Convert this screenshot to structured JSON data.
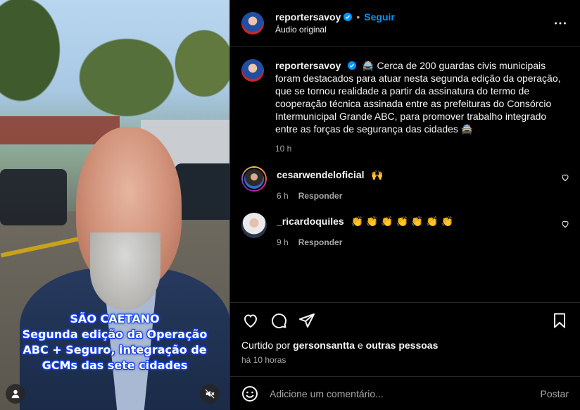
{
  "media": {
    "overlay_lines": [
      "SÃO CAETANO",
      "Segunda edição da Operação",
      "ABC + Seguro, integração de",
      "GCMs das sete cidades"
    ],
    "user_icon": "user-icon",
    "mute_icon": "muted-speaker-icon"
  },
  "header": {
    "username": "reportersavoy",
    "separator": "•",
    "follow_label": "Seguir",
    "audio_label": "Áudio original"
  },
  "caption": {
    "username": "reportersavoy",
    "text": "🚔 Cerca de 200 guardas civis municipais foram destacados para atuar nesta segunda edição da operação, que se tornou realidade a partir da assinatura do termo de cooperação técnica assinada entre as prefeituras do Consórcio Intermunicipal Grande ABC, para promover trabalho integrado entre as forças de segurança das cidades 🚔",
    "time": "10 h"
  },
  "comments": [
    {
      "username": "cesarwendeloficial",
      "text": "🙌",
      "time": "6 h",
      "reply_label": "Responder"
    },
    {
      "username": "_ricardoquiles",
      "text": "👏 👏 👏 👏 👏 👏 👏",
      "time": "9 h",
      "reply_label": "Responder"
    }
  ],
  "actions": {
    "liked_prefix": "Curtido por",
    "liked_user": "gersonsantta",
    "liked_connector": "e",
    "liked_others": "outras pessoas",
    "post_time": "há 10 horas"
  },
  "composer": {
    "placeholder": "Adicione um comentário...",
    "post_label": "Postar"
  },
  "colors": {
    "accent": "#0095f6",
    "verified": "#0095f6",
    "secondary_text": "#a8a8a8",
    "overlay_glow": "#1a4dff"
  }
}
